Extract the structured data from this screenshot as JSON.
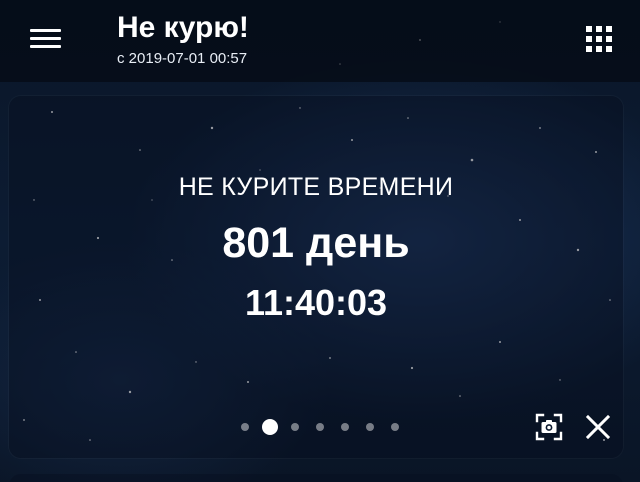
{
  "header": {
    "title": "Не курю!",
    "subtitle": "с 2019-07-01 00:57",
    "menu_icon": "hamburger-menu-icon",
    "apps_icon": "grid-apps-icon"
  },
  "card": {
    "label": "НЕ КУРИТЕ ВРЕМЕНИ",
    "days": "801 день",
    "time": "11:40:03",
    "pager": {
      "total": 7,
      "active_index": 1
    },
    "actions": {
      "screenshot_icon": "camera-icon",
      "close_icon": "close-icon"
    }
  },
  "colors": {
    "text": "#ffffff",
    "background": "#0a1628",
    "header_bg": "#040a14",
    "pager_inactive": "#8a93a3"
  }
}
